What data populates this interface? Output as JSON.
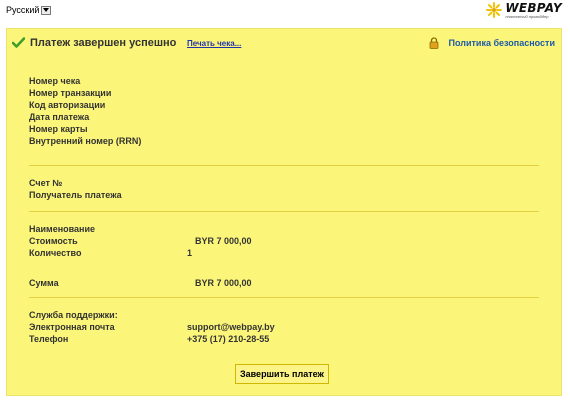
{
  "language": {
    "selected": "Русский"
  },
  "logo": {
    "name": "WEBPAY",
    "tagline": "платежный провайдер"
  },
  "header": {
    "title": "Платеж завершен успешно",
    "print_link": "Печать чека...",
    "security_link": "Политика безопасности"
  },
  "receipt": [
    {
      "label": "Номер чека",
      "value": ""
    },
    {
      "label": "Номер транзакции",
      "value": ""
    },
    {
      "label": "Код авторизации",
      "value": ""
    },
    {
      "label": "Дата платежа",
      "value": ""
    },
    {
      "label": "Номер карты",
      "value": ""
    },
    {
      "label": "Внутренний номер (RRN)",
      "value": ""
    }
  ],
  "invoice": [
    {
      "label": "Счет №",
      "value": ""
    },
    {
      "label": "Получатель платежа",
      "value": ""
    }
  ],
  "item": [
    {
      "label": "Наименование",
      "value": ""
    },
    {
      "label": "Стоимость",
      "value": "BYR 7 000,00"
    },
    {
      "label": "Количество",
      "value": "1"
    }
  ],
  "total": {
    "label": "Сумма",
    "value": "BYR 7 000,00"
  },
  "support": {
    "title": "Служба поддержки:",
    "rows": [
      {
        "label": "Электронная почта",
        "value": "support@webpay.by"
      },
      {
        "label": "Телефон",
        "value": "+375 (17) 210-28-55"
      }
    ]
  },
  "finish_button": "Завершить платеж",
  "colors": {
    "panel": "#fbf67a",
    "separator": "#e4d040",
    "link": "#1d5aa6"
  }
}
